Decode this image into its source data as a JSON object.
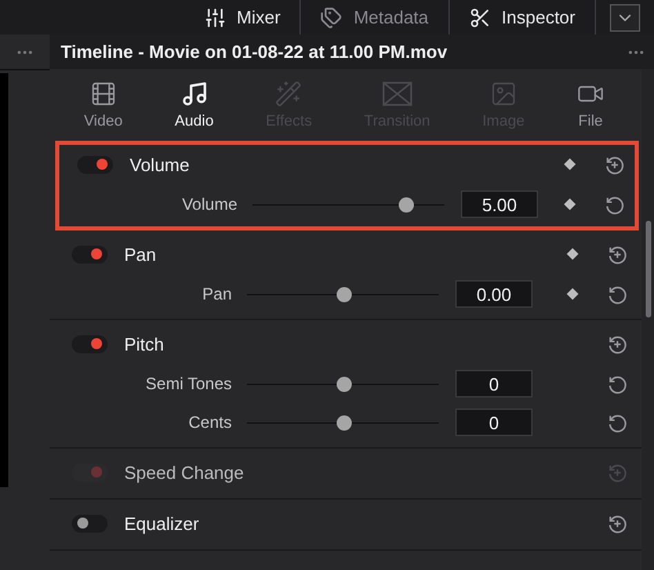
{
  "toolbar": {
    "items": [
      {
        "label": "Mixer",
        "active": true
      },
      {
        "label": "Metadata",
        "active": false
      },
      {
        "label": "Inspector",
        "active": true
      }
    ]
  },
  "header": {
    "title": "Timeline - Movie on 01-08-22 at 11.00 PM.mov"
  },
  "tabs": [
    {
      "label": "Video",
      "selected": false,
      "disabled": false
    },
    {
      "label": "Audio",
      "selected": true,
      "disabled": false
    },
    {
      "label": "Effects",
      "selected": false,
      "disabled": true
    },
    {
      "label": "Transition",
      "selected": false,
      "disabled": true
    },
    {
      "label": "Image",
      "selected": false,
      "disabled": true
    },
    {
      "label": "File",
      "selected": false,
      "disabled": false
    }
  ],
  "sections": [
    {
      "title": "Volume",
      "on": true,
      "disabled": false,
      "highlighted": true,
      "keyframe": true,
      "rows": [
        {
          "label": "Volume",
          "level": 0.8,
          "value": "5.00",
          "keyframe": true
        }
      ]
    },
    {
      "title": "Pan",
      "on": true,
      "disabled": false,
      "highlighted": false,
      "keyframe": true,
      "rows": [
        {
          "label": "Pan",
          "level": 0.5,
          "value": "0.00",
          "keyframe": true
        }
      ]
    },
    {
      "title": "Pitch",
      "on": true,
      "disabled": false,
      "highlighted": false,
      "keyframe": false,
      "rows": [
        {
          "label": "Semi Tones",
          "level": 0.5,
          "value": "0",
          "keyframe": false
        },
        {
          "label": "Cents",
          "level": 0.5,
          "value": "0",
          "keyframe": false
        }
      ]
    },
    {
      "title": "Speed Change",
      "on": true,
      "disabled": true,
      "highlighted": false,
      "keyframe": false
    },
    {
      "title": "Equalizer",
      "on": false,
      "disabled": false,
      "highlighted": false,
      "keyframe": false
    }
  ]
}
